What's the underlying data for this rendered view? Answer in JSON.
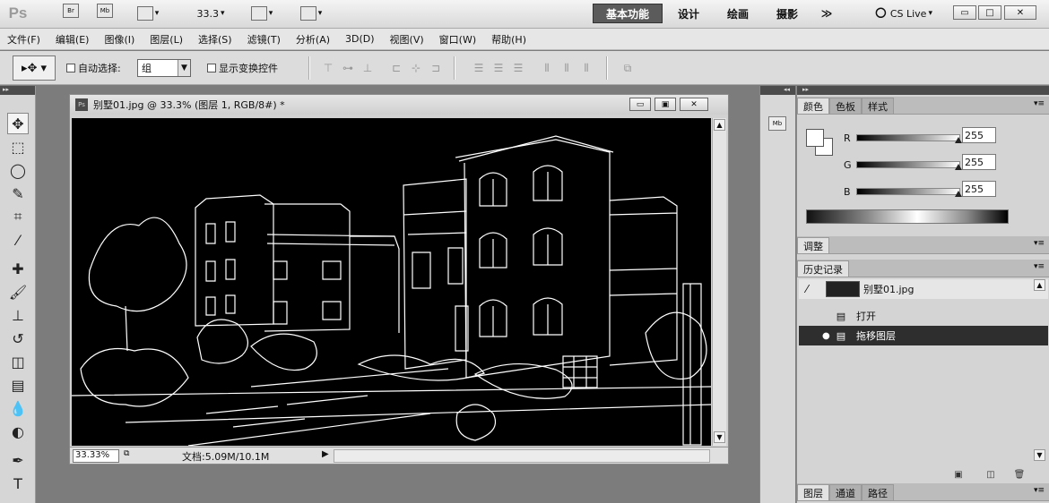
{
  "appbar": {
    "logo": "Ps",
    "zoom": "33.3",
    "workspaces": [
      "基本功能",
      "设计",
      "绘画",
      "摄影"
    ],
    "overflow": "≫",
    "cs_live": "CS Live",
    "launch_bridge": "Br",
    "mini_bridge": "Mb"
  },
  "menu": [
    "文件(F)",
    "编辑(E)",
    "图像(I)",
    "图层(L)",
    "选择(S)",
    "滤镜(T)",
    "分析(A)",
    "3D(D)",
    "视图(V)",
    "窗口(W)",
    "帮助(H)"
  ],
  "options": {
    "auto_select_label": "自动选择:",
    "auto_select_value": "组",
    "show_transform_label": "显示变换控件"
  },
  "document": {
    "title": "别墅01.jpg @ 33.3% (图层 1, RGB/8#) *",
    "zoom": "33.33%",
    "doc_size": "文档:5.09M/10.1M"
  },
  "color_panel": {
    "tabs": [
      "颜色",
      "色板",
      "样式"
    ],
    "channels": [
      {
        "label": "R",
        "value": "255"
      },
      {
        "label": "G",
        "value": "255"
      },
      {
        "label": "B",
        "value": "255"
      }
    ],
    "foreground": "#ffffff",
    "background": "#ffffff"
  },
  "adjust_panel": {
    "tab": "调整"
  },
  "history_panel": {
    "tab": "历史记录",
    "snapshot": "别墅01.jpg",
    "steps": [
      {
        "label": "打开",
        "selected": false
      },
      {
        "label": "拖移图层",
        "selected": true
      }
    ]
  },
  "layers_panel": {
    "tabs": [
      "图层",
      "通道",
      "路径"
    ]
  }
}
